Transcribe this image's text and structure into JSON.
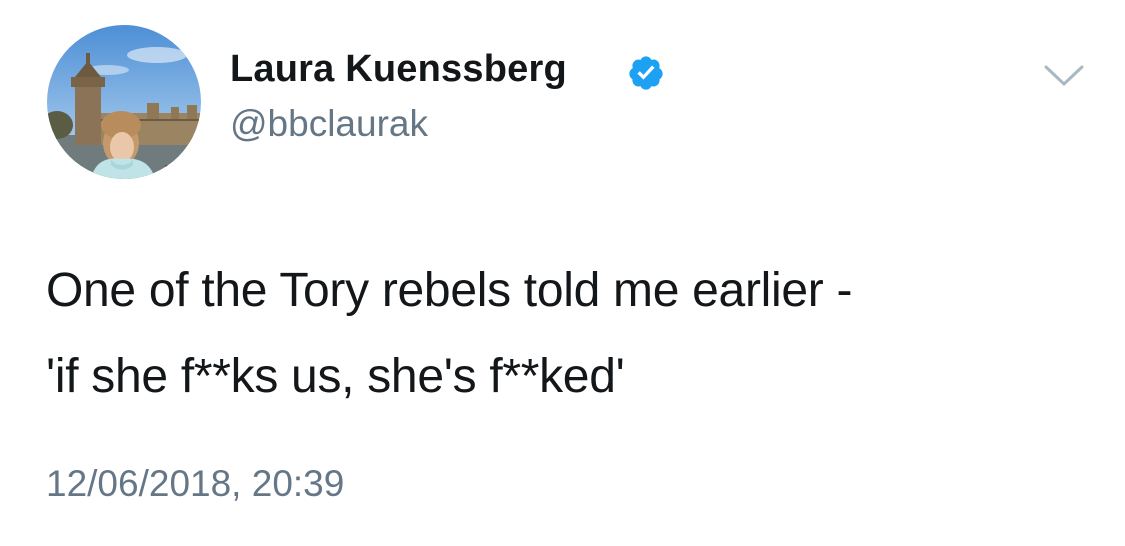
{
  "author": {
    "display_name": "Laura Kuenssberg",
    "handle": "@bbclaurak",
    "verified": true,
    "avatar_icon": "profile-photo"
  },
  "tweet": {
    "lines": [
      "One of the Tory rebels told me earlier -",
      "'if she f**ks us, she's f**ked'"
    ],
    "timestamp": "12/06/2018, 20:39"
  },
  "menu": {
    "icon": "chevron-down-icon"
  },
  "colors": {
    "text": "#14171a",
    "secondary": "#657786",
    "verified_blue": "#1da1f2"
  }
}
